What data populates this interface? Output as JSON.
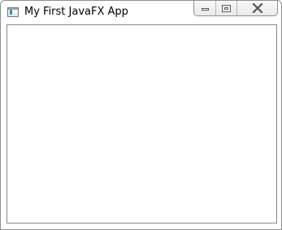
{
  "window": {
    "title": "My First JavaFX App"
  },
  "icons": {
    "app": "javafx-app-icon",
    "minimize": "minimize-icon",
    "maximize": "maximize-icon",
    "close": "close-icon"
  },
  "colors": {
    "frame_border": "#8e8e8e",
    "content_border": "#828790",
    "background": "#ffffff"
  }
}
